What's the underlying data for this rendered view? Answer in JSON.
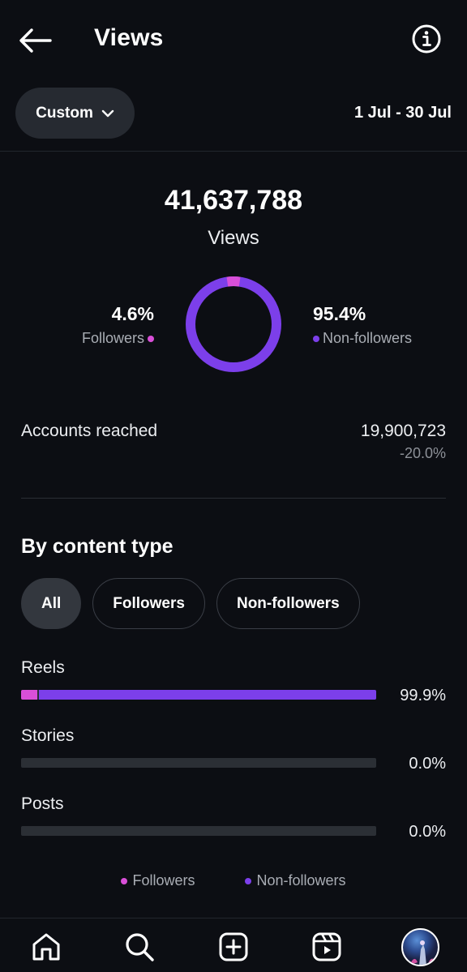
{
  "header": {
    "title": "Views",
    "back_icon": "arrow-left-icon",
    "info_icon": "info-icon"
  },
  "filter": {
    "period_label": "Custom",
    "date_range": "1 Jul - 30 Jul"
  },
  "summary": {
    "total": "41,637,788",
    "total_label": "Views",
    "followers_pct": "4.6%",
    "followers_label": "Followers",
    "nonfollowers_pct": "95.4%",
    "nonfollowers_label": "Non-followers",
    "followers_fraction": 0.046
  },
  "reach": {
    "label": "Accounts reached",
    "value": "19,900,723",
    "change": "-20.0%"
  },
  "content_type": {
    "title": "By content type",
    "chips": [
      "All",
      "Followers",
      "Non-followers"
    ],
    "active_chip": "All",
    "rows": [
      {
        "label": "Reels",
        "pct": "99.9%",
        "followers_fraction": 0.046,
        "nonfollowers_fraction": 0.953
      },
      {
        "label": "Stories",
        "pct": "0.0%",
        "followers_fraction": 0,
        "nonfollowers_fraction": 0
      },
      {
        "label": "Posts",
        "pct": "0.0%",
        "followers_fraction": 0,
        "nonfollowers_fraction": 0
      }
    ],
    "legend": {
      "followers": "Followers",
      "nonfollowers": "Non-followers"
    }
  },
  "colors": {
    "followers": "#d94fd8",
    "nonfollowers": "#7c3fea",
    "background": "#0c0e13"
  },
  "nav": [
    "home-icon",
    "search-icon",
    "create-icon",
    "reels-icon",
    "profile-avatar"
  ]
}
